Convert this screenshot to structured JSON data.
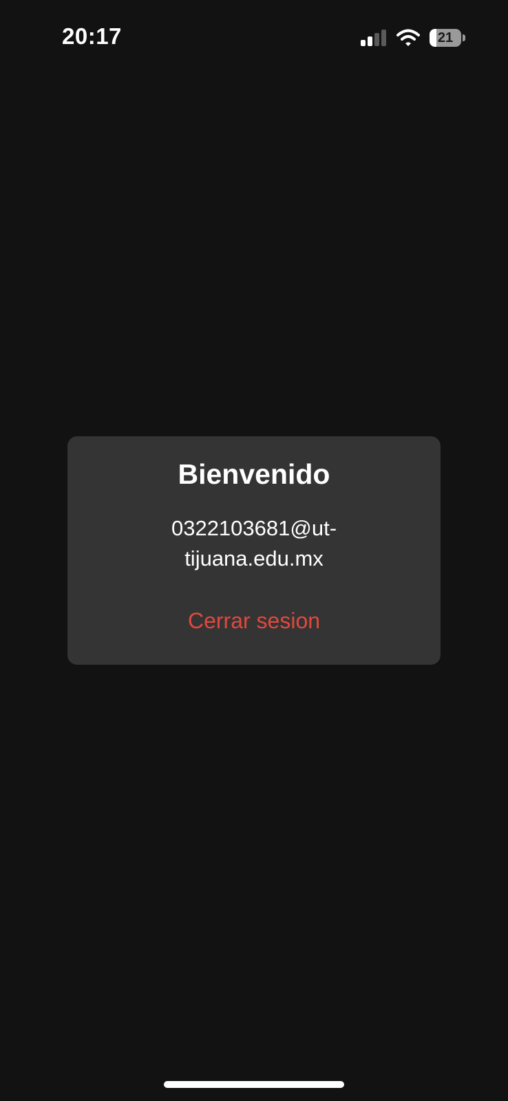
{
  "status_bar": {
    "time": "20:17",
    "battery_level": "21",
    "battery_fraction": 0.21,
    "signal_icon": "cellular-signal-icon",
    "wifi_icon": "wifi-icon"
  },
  "dialog": {
    "title": "Bienvenido",
    "email": "0322103681@ut-tijuana.edu.mx",
    "logout_label": "Cerrar sesion",
    "logout_color": "#e2483d"
  },
  "colors": {
    "background": "#121212",
    "dialog_background": "#343434",
    "text": "#ffffff"
  }
}
